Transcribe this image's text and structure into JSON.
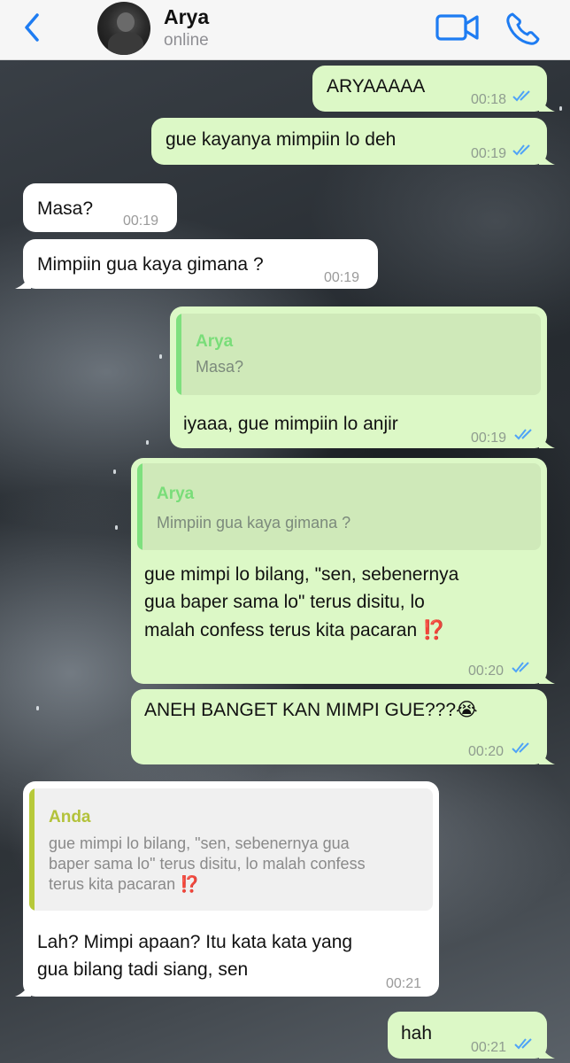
{
  "header": {
    "back_icon": "chevron-left-icon",
    "contact_name": "Arya",
    "status": "online",
    "video_icon": "video-camera-icon",
    "phone_icon": "phone-icon"
  },
  "colors": {
    "accent": "#1e7cf2",
    "outgoing_bubble": "#dcf8c6",
    "incoming_bubble": "#ffffff",
    "read_ticks": "#4fa3f7",
    "quote_bar_contact": "#7ee07e",
    "quote_bar_self": "#b7c93a"
  },
  "messages": [
    {
      "direction": "out",
      "text": "ARYAAAAA",
      "time": "00:18",
      "status": "read"
    },
    {
      "direction": "out",
      "text": "gue kayanya mimpiin lo deh",
      "time": "00:19",
      "status": "read"
    },
    {
      "direction": "in",
      "text": "Masa?",
      "time": "00:19"
    },
    {
      "direction": "in",
      "text": "Mimpiin gua kaya gimana ?",
      "time": "00:19"
    },
    {
      "direction": "out",
      "quote_name": "Arya",
      "quote_text": "Masa?",
      "text": "iyaaa, gue mimpiin lo anjir",
      "time": "00:19",
      "status": "read"
    },
    {
      "direction": "out",
      "quote_name": "Arya",
      "quote_text": "Mimpiin gua kaya gimana ?",
      "lines": [
        "gue mimpi lo bilang, \"sen, sebenernya",
        "gua baper sama lo\" terus disitu, lo",
        "malah confess terus kita pacaran"
      ],
      "emoji": "⁉️",
      "time": "00:20",
      "status": "read"
    },
    {
      "direction": "out",
      "text": "ANEH BANGET KAN MIMPI GUE???",
      "emoji": "😭",
      "time": "00:20",
      "status": "read"
    },
    {
      "direction": "in",
      "quote_name": "Anda",
      "quote_lines": [
        "gue mimpi lo bilang, \"sen, sebenernya gua",
        "baper sama lo\" terus disitu, lo malah confess",
        "terus kita pacaran"
      ],
      "quote_emoji": "⁉️",
      "lines": [
        "Lah? Mimpi apaan? Itu kata kata yang",
        "gua bilang tadi siang, sen"
      ],
      "time": "00:21"
    },
    {
      "direction": "out",
      "text": "hah",
      "time": "00:21",
      "status": "read"
    }
  ]
}
